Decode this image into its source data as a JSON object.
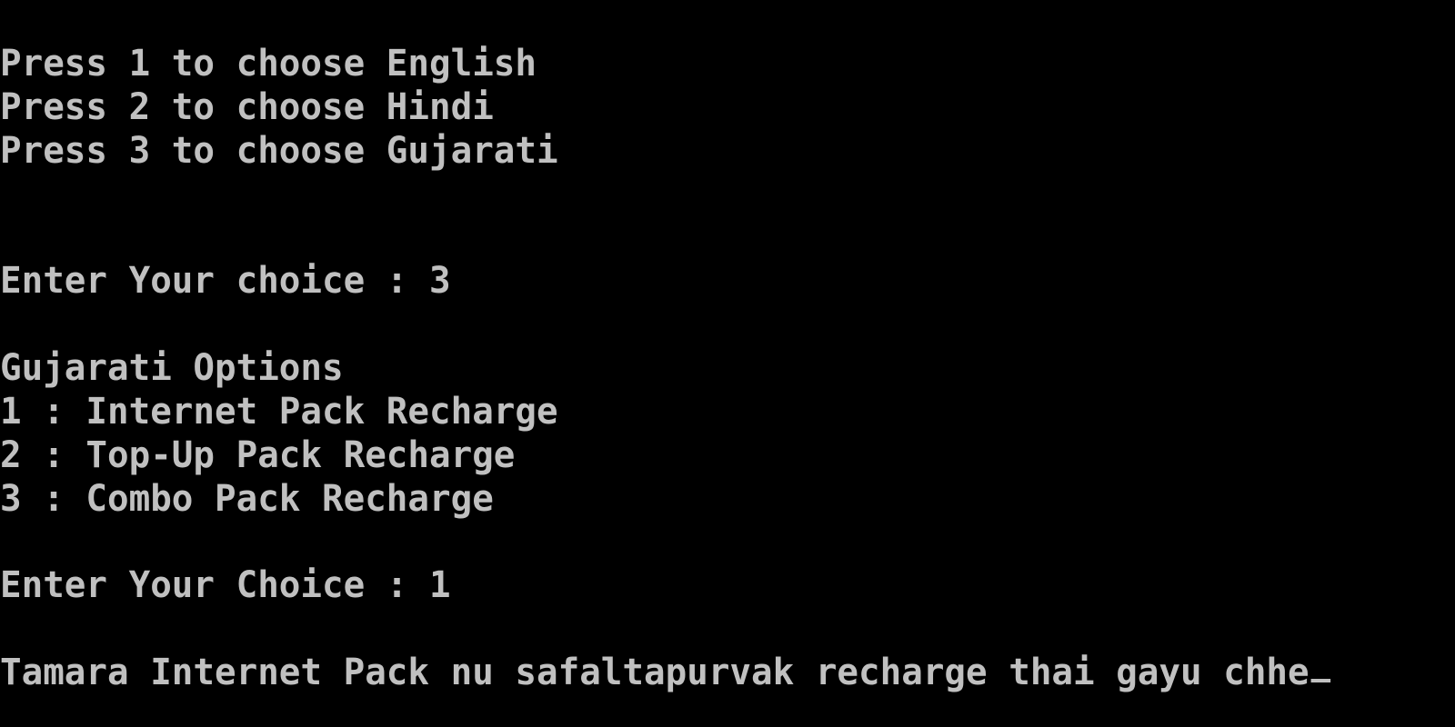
{
  "console": {
    "language_menu": [
      "Press 1 to choose English",
      "Press 2 to choose Hindi",
      "Press 3 to choose Gujarati"
    ],
    "language_prompt": "Enter Your choice : 3",
    "options_heading": "Gujarati Options",
    "options": [
      "1 : Internet Pack Recharge",
      "2 : Top-Up Pack Recharge",
      "3 : Combo Pack Recharge"
    ],
    "option_prompt": "Enter Your Choice : 1",
    "result_message": "Tamara Internet Pack nu safaltapurvak recharge thai gayu chhe"
  },
  "colors": {
    "background": "#000000",
    "text": "#c0c0c0"
  }
}
